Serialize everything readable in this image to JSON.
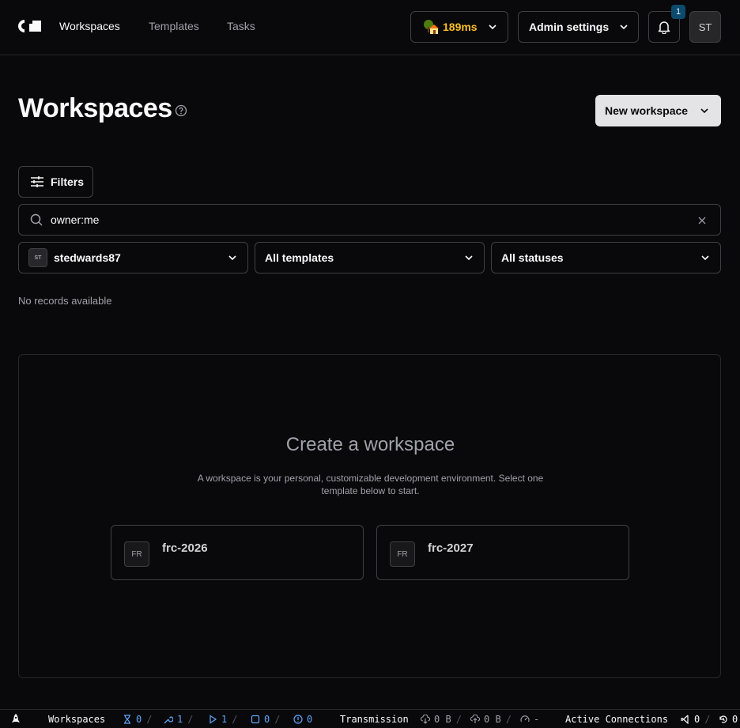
{
  "nav": {
    "links": [
      "Workspaces",
      "Templates",
      "Tasks"
    ],
    "latency": "189ms",
    "admin_label": "Admin settings",
    "notification_count": "1",
    "avatar_initials": "ST"
  },
  "page": {
    "title": "Workspaces",
    "new_workspace_label": "New workspace",
    "filters_label": "Filters",
    "search_value": "owner:me",
    "owner_avatar": "ST",
    "owner_select": "stedwards87",
    "template_select": "All templates",
    "status_select": "All statuses",
    "no_records": "No records available"
  },
  "empty_state": {
    "title": "Create a workspace",
    "description": "A workspace is your personal, customizable development environment. Select one template below to start.",
    "templates": [
      {
        "icon": "FR",
        "name": "frc-2026"
      },
      {
        "icon": "FR",
        "name": "frc-2027"
      }
    ]
  },
  "statusbar": {
    "workspaces_label": "Workspaces",
    "pending": "0",
    "starting": "1",
    "running": "1",
    "stopped": "0",
    "failed": "0",
    "transmission_label": "Transmission",
    "download": "0 B",
    "upload": "0 B",
    "latency": "-",
    "connections_label": "Active Connections",
    "vscode_count": "0",
    "ssh_count": "0"
  },
  "colors": {
    "accent": "#60a5fa",
    "latency": "#fbbf24",
    "background": "#09090b"
  }
}
